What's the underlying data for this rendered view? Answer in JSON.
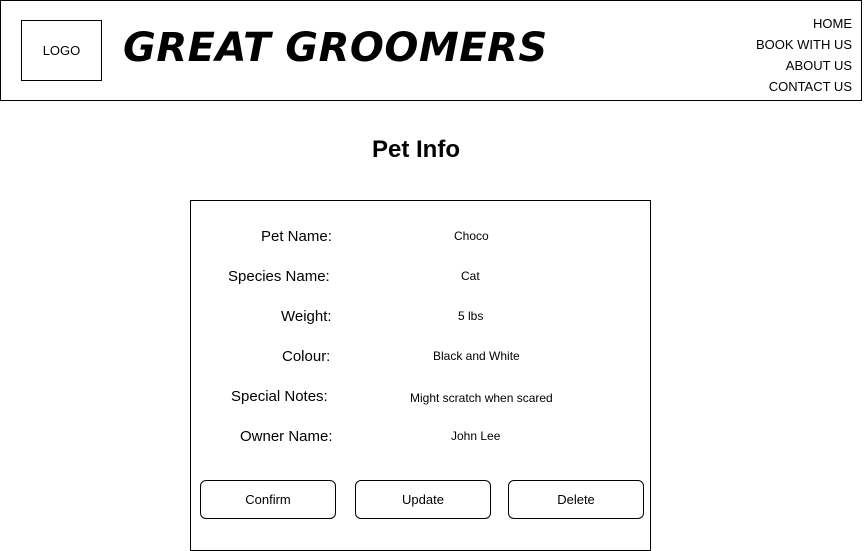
{
  "header": {
    "logo_text": "LOGO",
    "brand": "GREAT GROOMERS",
    "nav": [
      "HOME",
      "BOOK WITH US",
      "ABOUT US",
      "CONTACT US"
    ]
  },
  "page": {
    "title": "Pet Info"
  },
  "pet": {
    "rows": [
      {
        "label": "Pet Name:",
        "value": "Choco"
      },
      {
        "label": "Species Name:",
        "value": "Cat"
      },
      {
        "label": "Weight:",
        "value": "5 lbs"
      },
      {
        "label": "Colour:",
        "value": "Black and White"
      },
      {
        "label": "Special Notes:",
        "value": "Might scratch when scared"
      },
      {
        "label": "Owner Name:",
        "value": "John Lee"
      }
    ]
  },
  "actions": {
    "confirm": "Confirm",
    "update": "Update",
    "delete": "Delete"
  }
}
